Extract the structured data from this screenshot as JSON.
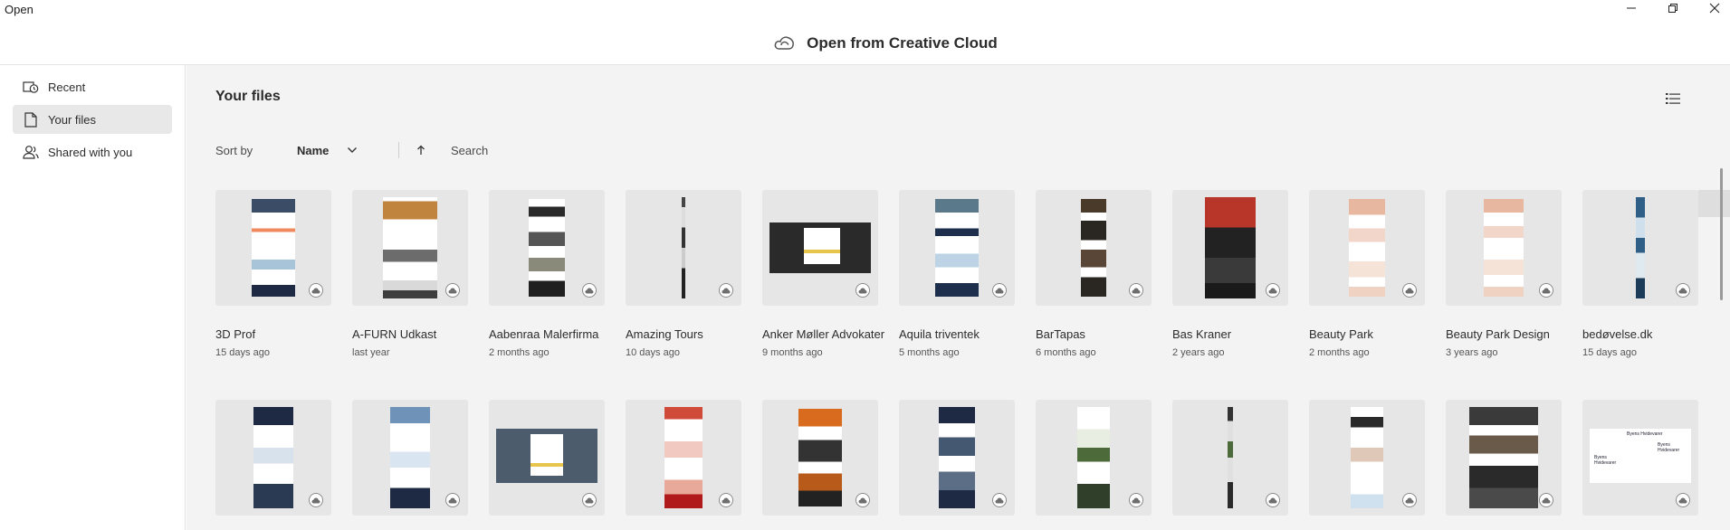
{
  "window": {
    "title": "Open"
  },
  "header": {
    "title": "Open from Creative Cloud",
    "logo_icon": "creative-cloud-icon"
  },
  "sidebar": {
    "items": [
      {
        "label": "Recent",
        "icon": "recent-icon",
        "active": false
      },
      {
        "label": "Your files",
        "icon": "file-icon",
        "active": true
      },
      {
        "label": "Shared with you",
        "icon": "user-icon",
        "active": false
      }
    ]
  },
  "main": {
    "title": "Your files",
    "sort_label": "Sort by",
    "sort_value": "Name",
    "search_placeholder": "Search",
    "views": [
      "list-view-icon",
      "grid-view-icon"
    ],
    "active_view": "grid"
  },
  "files": [
    {
      "name": "3D Prof",
      "date": "15 days ago"
    },
    {
      "name": "A-FURN Udkast",
      "date": "last year"
    },
    {
      "name": "Aabenraa Malerfirma",
      "date": "2 months ago"
    },
    {
      "name": "Amazing Tours",
      "date": "10 days ago"
    },
    {
      "name": "Anker Møller Advokater",
      "date": "9 months ago"
    },
    {
      "name": "Aquila triventek",
      "date": "5 months ago"
    },
    {
      "name": "BarTapas",
      "date": "6 months ago"
    },
    {
      "name": "Bas Kraner",
      "date": "2 years ago"
    },
    {
      "name": "Beauty Park",
      "date": "2 months ago"
    },
    {
      "name": "Beauty Park Design",
      "date": "3 years ago"
    },
    {
      "name": "bedøvelse.dk",
      "date": "15 days ago"
    }
  ],
  "row2_thumbnail_text": {
    "brand": "Byens Hvidevarer",
    "lines": [
      "Byens Hvidevarer",
      "Byens",
      "Hvidevarer"
    ]
  },
  "colors": {
    "accent_dark": "#1e2a44",
    "tile_bg": "#e6e6e6",
    "main_bg": "#f3f3f3",
    "active_side": "#e8e8e8"
  }
}
